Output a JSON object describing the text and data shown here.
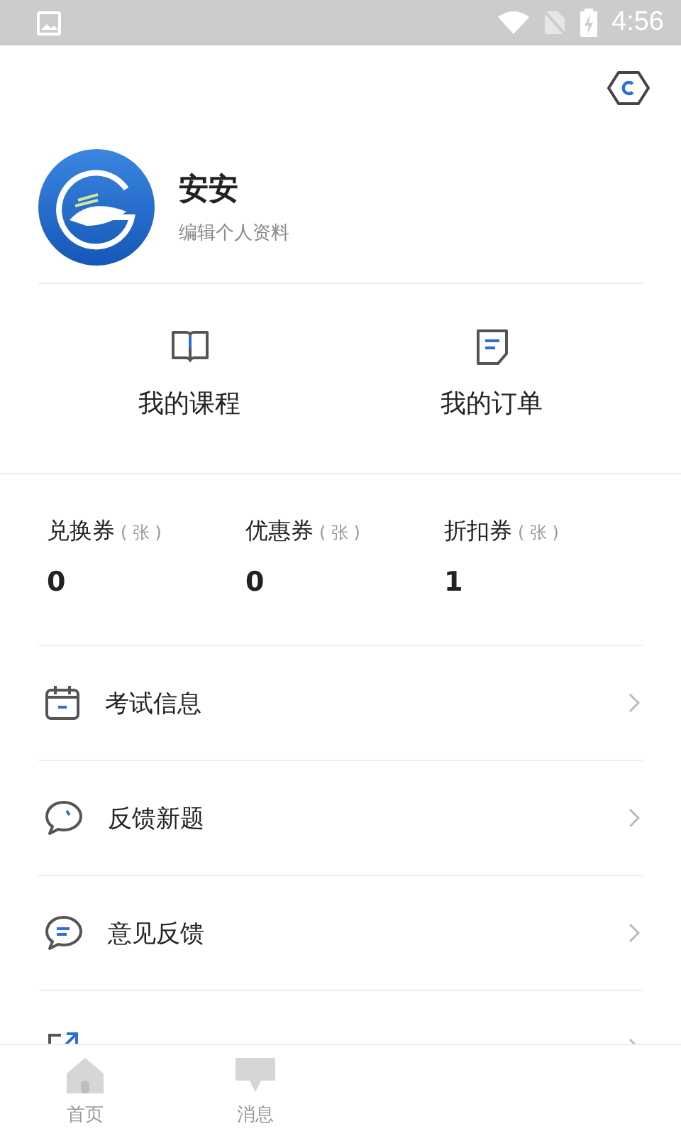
{
  "status_bar": {
    "time": "4:56"
  },
  "profile": {
    "name": "安安",
    "subtitle": "编辑个人资料"
  },
  "shortcuts": [
    {
      "kind": "book",
      "label": "我的课程"
    },
    {
      "kind": "order",
      "label": "我的订单"
    }
  ],
  "coupons": [
    {
      "label": "兑换券",
      "unit": "( 张 )",
      "count": "0"
    },
    {
      "label": "优惠券",
      "unit": "( 张 )",
      "count": "0"
    },
    {
      "label": "折扣券",
      "unit": "( 张 )",
      "count": "1"
    }
  ],
  "menu": [
    {
      "kind": "calendar",
      "label": "考试信息"
    },
    {
      "kind": "bubble",
      "label": "反馈新题"
    },
    {
      "kind": "chat",
      "label": "意见反馈"
    },
    {
      "kind": "share"
    }
  ],
  "tab_bar": [
    {
      "kind": "home",
      "label": "首页"
    },
    {
      "kind": "message",
      "label": "消息"
    }
  ]
}
